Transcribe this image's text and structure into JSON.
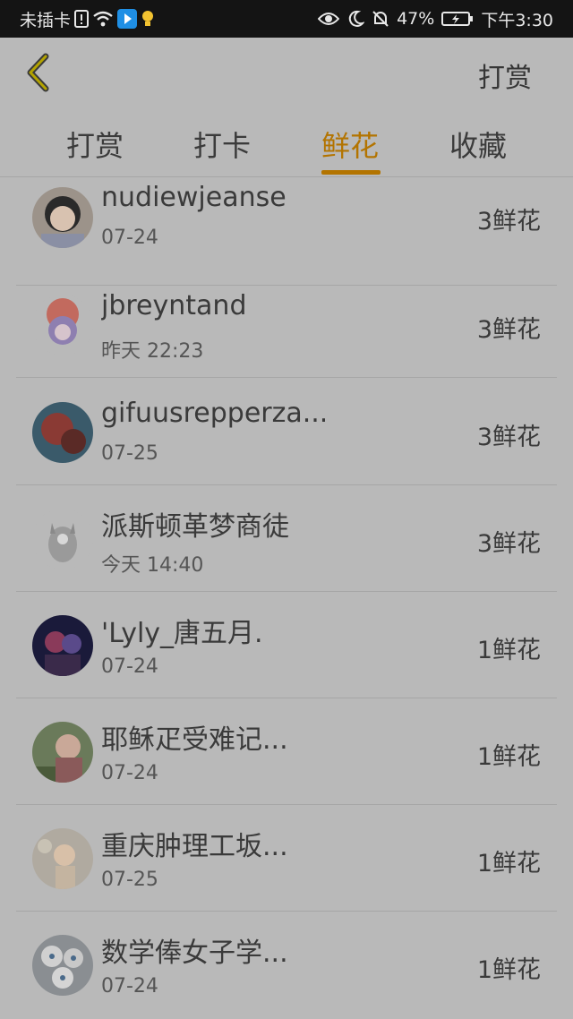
{
  "statusbar": {
    "carrier": "未插卡",
    "battery": "47%",
    "time": "下午3:30"
  },
  "header": {
    "back_icon": "chevron-left-icon",
    "action": "打赏"
  },
  "tabs": [
    "打赏",
    "打卡",
    "鲜花",
    "收藏"
  ],
  "active_tab": "鲜花",
  "colors": {
    "accent": "#b37400",
    "background": "#b9b9b9",
    "statusbar": "#141414"
  },
  "items": [
    {
      "name": "nudiewjeanse",
      "time": "07-24",
      "amount": "3鲜花"
    },
    {
      "name": "jbreyntand",
      "time": "昨天 22:23",
      "amount": "3鲜花"
    },
    {
      "name": "gifuusrepperza...",
      "time": "07-25",
      "amount": "3鲜花"
    },
    {
      "name": "派斯顿革梦商徒",
      "time": "今天 14:40",
      "amount": "3鲜花"
    },
    {
      "name": "'Lyly_唐五月.",
      "time": "07-24",
      "amount": "1鲜花"
    },
    {
      "name": "耶稣疋受难记...",
      "time": "07-24",
      "amount": "1鲜花"
    },
    {
      "name": "重庆肿理工坂...",
      "time": "07-25",
      "amount": "1鲜花"
    },
    {
      "name": "数学俸女子学...",
      "time": "07-24",
      "amount": "1鲜花"
    }
  ]
}
